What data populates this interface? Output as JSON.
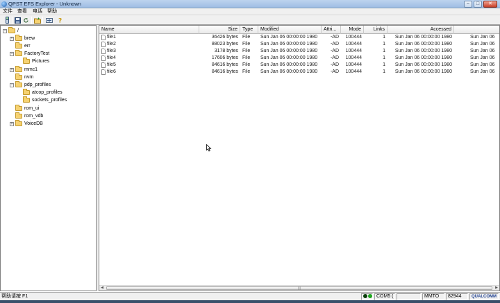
{
  "window": {
    "title": "QPST EFS Explorer - Unknown",
    "min": "–",
    "max": "□",
    "close": "✕"
  },
  "menu": [
    {
      "label": "文件"
    },
    {
      "label": "查看"
    },
    {
      "label": "电话"
    },
    {
      "label": "帮助"
    }
  ],
  "toolbar_icons": [
    "phone-icon",
    "save-icon",
    "refresh-icon",
    "new-folder-icon",
    "tools-icon",
    "help-icon"
  ],
  "tree": {
    "root": "/",
    "items": [
      {
        "label": "brew"
      },
      {
        "label": "err"
      },
      {
        "label": "FactoryTest"
      },
      {
        "label": "Pictures"
      },
      {
        "label": "mmc1"
      },
      {
        "label": "nvm"
      },
      {
        "label": "pdp_profiles"
      },
      {
        "label": "atcop_profiles"
      },
      {
        "label": "sockets_profiles"
      },
      {
        "label": "rom_ui"
      },
      {
        "label": "rom_vdb"
      },
      {
        "label": "VoiceDB"
      }
    ]
  },
  "list": {
    "columns": [
      {
        "label": "Name"
      },
      {
        "label": "Size"
      },
      {
        "label": "Type"
      },
      {
        "label": "Modified"
      },
      {
        "label": "Attri..."
      },
      {
        "label": "Mode"
      },
      {
        "label": "Links"
      },
      {
        "label": "Accessed"
      },
      {
        "label": ""
      }
    ],
    "rows": [
      {
        "name": "file1",
        "size": "36426 bytes",
        "type": "File",
        "modified": "Sun Jan 06 00:00:00 1980",
        "attr": "-AD",
        "mode": "100444",
        "links": "1",
        "accessed": "Sun Jan 06 00:00:00 1980",
        "extra": "Sun Jan 06"
      },
      {
        "name": "file2",
        "size": "88023 bytes",
        "type": "File",
        "modified": "Sun Jan 06 00:00:00 1980",
        "attr": "-AD",
        "mode": "100444",
        "links": "1",
        "accessed": "Sun Jan 06 00:00:00 1980",
        "extra": "Sun Jan 06"
      },
      {
        "name": "file3",
        "size": "3178 bytes",
        "type": "File",
        "modified": "Sun Jan 06 00:00:00 1980",
        "attr": "-AD",
        "mode": "100444",
        "links": "1",
        "accessed": "Sun Jan 06 00:00:00 1980",
        "extra": "Sun Jan 06"
      },
      {
        "name": "file4",
        "size": "17606 bytes",
        "type": "File",
        "modified": "Sun Jan 06 00:00:00 1980",
        "attr": "-AD",
        "mode": "100444",
        "links": "1",
        "accessed": "Sun Jan 06 00:00:00 1980",
        "extra": "Sun Jan 06"
      },
      {
        "name": "file5",
        "size": "84616 bytes",
        "type": "File",
        "modified": "Sun Jan 06 00:00:00 1980",
        "attr": "-AD",
        "mode": "100444",
        "links": "1",
        "accessed": "Sun Jan 06 00:00:00 1980",
        "extra": "Sun Jan 06"
      },
      {
        "name": "file6",
        "size": "84616 bytes",
        "type": "File",
        "modified": "Sun Jan 06 00:00:00 1980",
        "attr": "-AD",
        "mode": "100444",
        "links": "1",
        "accessed": "Sun Jan 06 00:00:00 1980",
        "extra": "Sun Jan 06"
      }
    ]
  },
  "status": {
    "help_text": "帮助请按 F1",
    "port": "COM5 (",
    "mode": "MMTO",
    "number": "82944",
    "brand": "QUALCOMM"
  },
  "colors": {
    "link_green": "#1fa51f",
    "link_dark": "#0a3d0a"
  }
}
